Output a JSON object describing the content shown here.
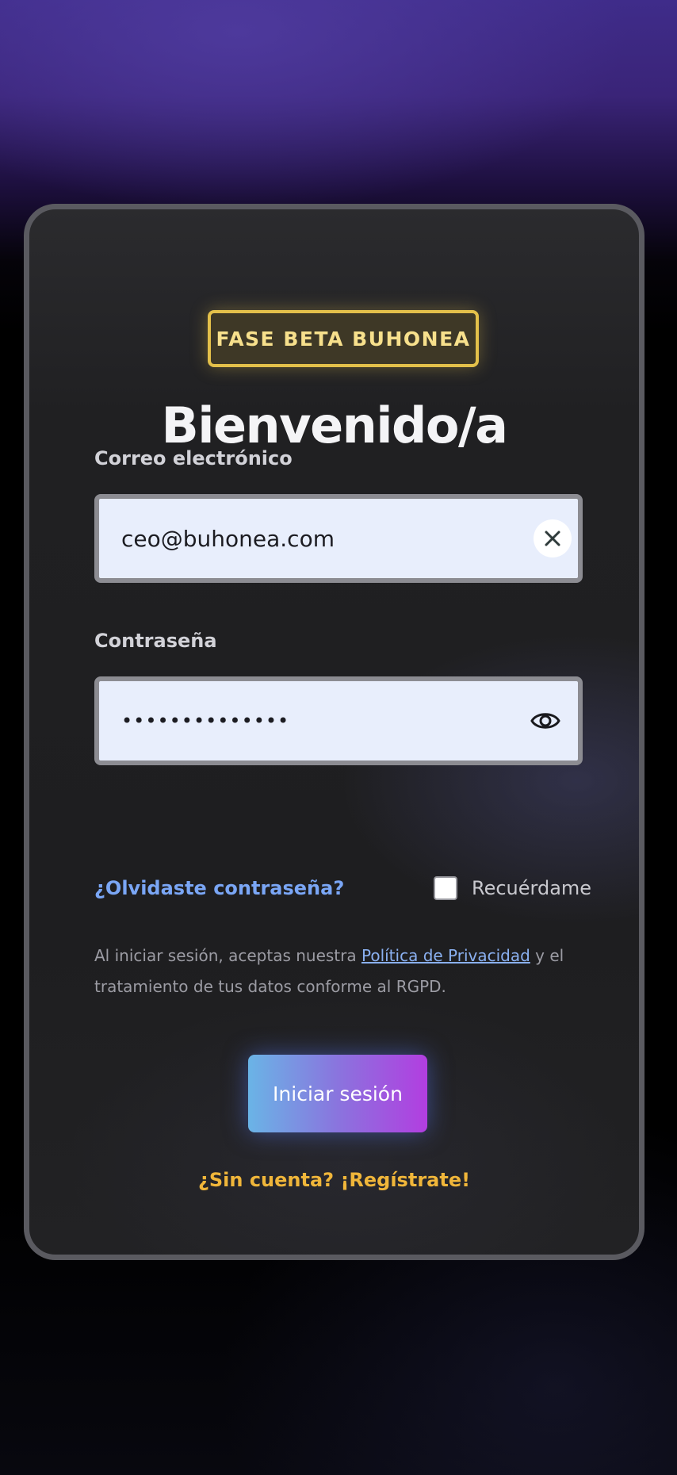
{
  "badge": {
    "label": "FASE BETA BUHONEA",
    "color": "#e3c04a"
  },
  "title": "Bienvenido/a",
  "email": {
    "label": "Correo electrónico",
    "value": "ceo@buhonea.com",
    "clear_icon": "close-icon"
  },
  "password": {
    "label": "Contraseña",
    "value": "••••••••••••••",
    "toggle_icon": "eye-icon"
  },
  "forgot_link": "¿Olvidaste contraseña?",
  "remember_label": "Recuérdame",
  "privacy": {
    "prefix": "Al iniciar sesión, aceptas nuestra ",
    "link": "Política de Privacidad",
    "suffix": " y el tratamiento de tus datos conforme al RGPD."
  },
  "submit_label": "Iniciar sesión",
  "register_link": "¿Sin cuenta? ¡Regístrate!",
  "colors": {
    "accent_link": "#7aa6f5",
    "register": "#f0b63a",
    "button_gradient_start": "#6ab4e6",
    "button_gradient_end": "#b23ee0"
  }
}
